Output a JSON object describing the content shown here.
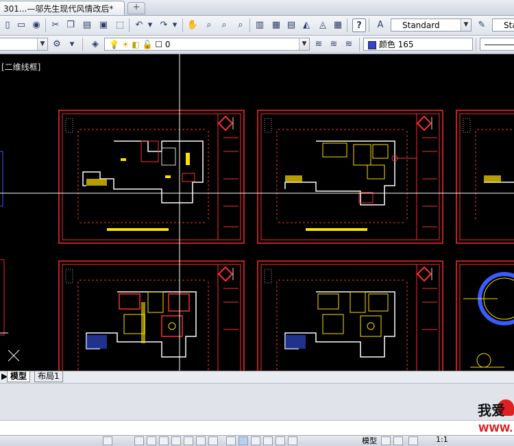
{
  "window": {
    "doc_tab_title": "301...—邬先生现代风情改后*",
    "new_tab_symbol": "+"
  },
  "toolbar1": {
    "text_style": "Standard",
    "dim_style_partial": "Sta"
  },
  "toolbar2": {
    "layer_value": "0",
    "color_label": "颜色 165",
    "color_hex": "#3344cc"
  },
  "canvas": {
    "view_label": "[二维线框]"
  },
  "layout_tabs": [
    {
      "label": "模型"
    },
    {
      "label": "布局1"
    }
  ],
  "statusbar": {
    "model_label": "模型",
    "scale_label": "1:1"
  },
  "watermark": {
    "line1": "我爱",
    "line2": "WWW."
  }
}
